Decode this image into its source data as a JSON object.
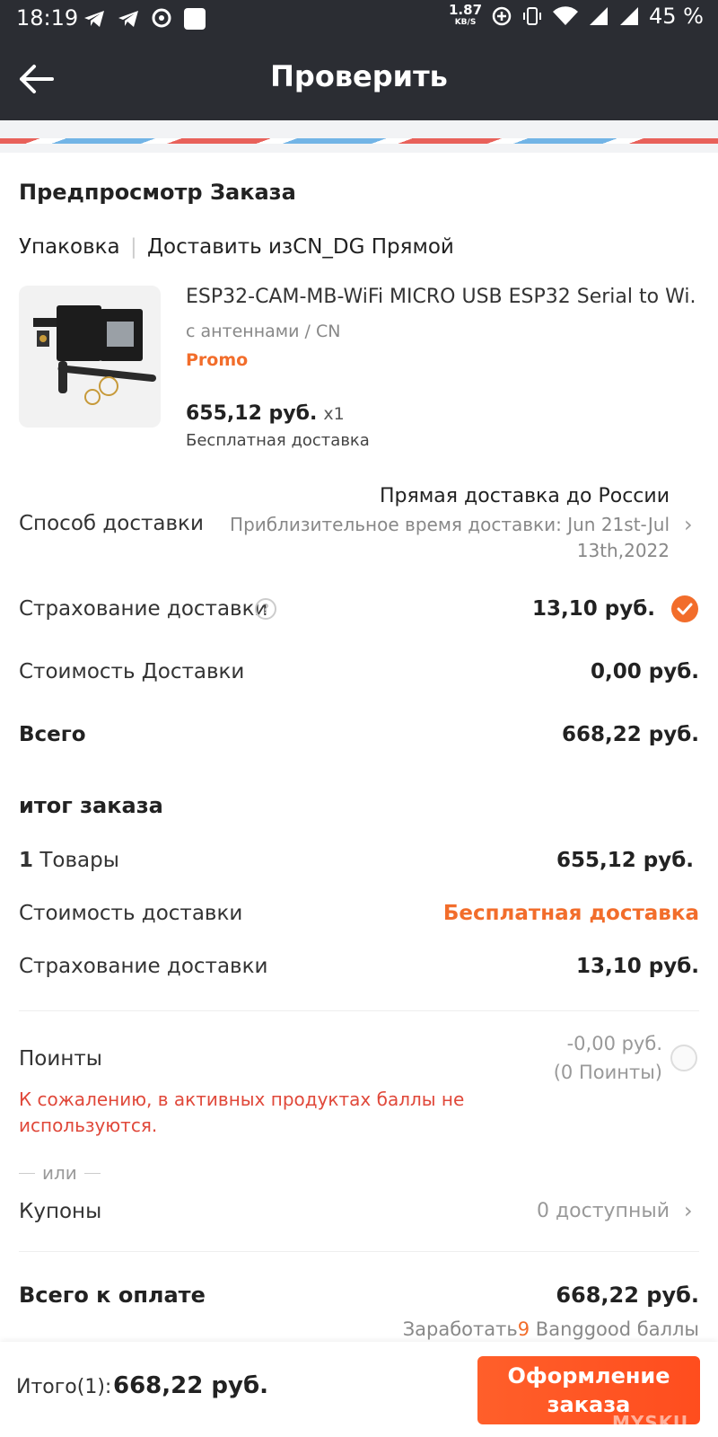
{
  "status_bar": {
    "time": "18:19",
    "net_speed": "1.87",
    "net_unit": "KB/S",
    "battery": "45 %"
  },
  "header": {
    "title": "Проверить"
  },
  "order_preview": {
    "title": "Предпросмотр Заказа",
    "packaging_label": "Упаковка",
    "ship_from": "Доставить изCN_DG Прямой"
  },
  "product": {
    "name": "ESP32-CAM-MB-WiFi MICRO USB ESP32 Serial to Wi...",
    "variant": "с антеннами / CN",
    "promo": "Promo",
    "price": "655,12 руб.",
    "qty": "x1",
    "shipping_note": "Бесплатная доставка"
  },
  "shipping": {
    "label": "Способ доставки",
    "method": "Прямая доставка до России",
    "eta_line1": "Приблизительное время доставки: Jun 21st-Jul",
    "eta_line2": "13th,2022"
  },
  "insurance": {
    "label": "Страхование доставки",
    "help": "?",
    "value": "13,10 руб."
  },
  "shipping_cost": {
    "label": "Стоимость Доставки",
    "value": "0,00 руб."
  },
  "total": {
    "label": "Всего",
    "value": "668,22 руб."
  },
  "summary": {
    "title": "итог заказа",
    "items_count": "1",
    "items_label": "Товары",
    "items_value": "655,12 руб.",
    "shipping_label": "Стоимость доставки",
    "shipping_value": "Бесплатная доставка",
    "insurance_label": "Страхование доставки",
    "insurance_value": "13,10 руб."
  },
  "points": {
    "label": "Поинты",
    "value_line1": "-0,00 руб.",
    "value_line2": "(0 Поинты)",
    "warning_line1": "К сожалению, в активных продуктах баллы не",
    "warning_line2": "используются.",
    "or": "или"
  },
  "coupons": {
    "label": "Купоны",
    "value": "0 доступный"
  },
  "grand_total": {
    "label": "Всего к оплате",
    "value": "668,22 руб.",
    "earn_prefix": "Заработать",
    "earn_points": "9",
    "earn_suffix": "Banggood баллы"
  },
  "bottom_bar": {
    "subtotal_label": "Итого(1):",
    "subtotal_value": "668,22 руб.",
    "checkout_line1": "Оформление",
    "checkout_line2": "заказа",
    "watermark": "MYSKU"
  },
  "colors": {
    "accent": "#f26d2b",
    "header_bg": "#2b2d33",
    "warning": "#e0483a"
  }
}
